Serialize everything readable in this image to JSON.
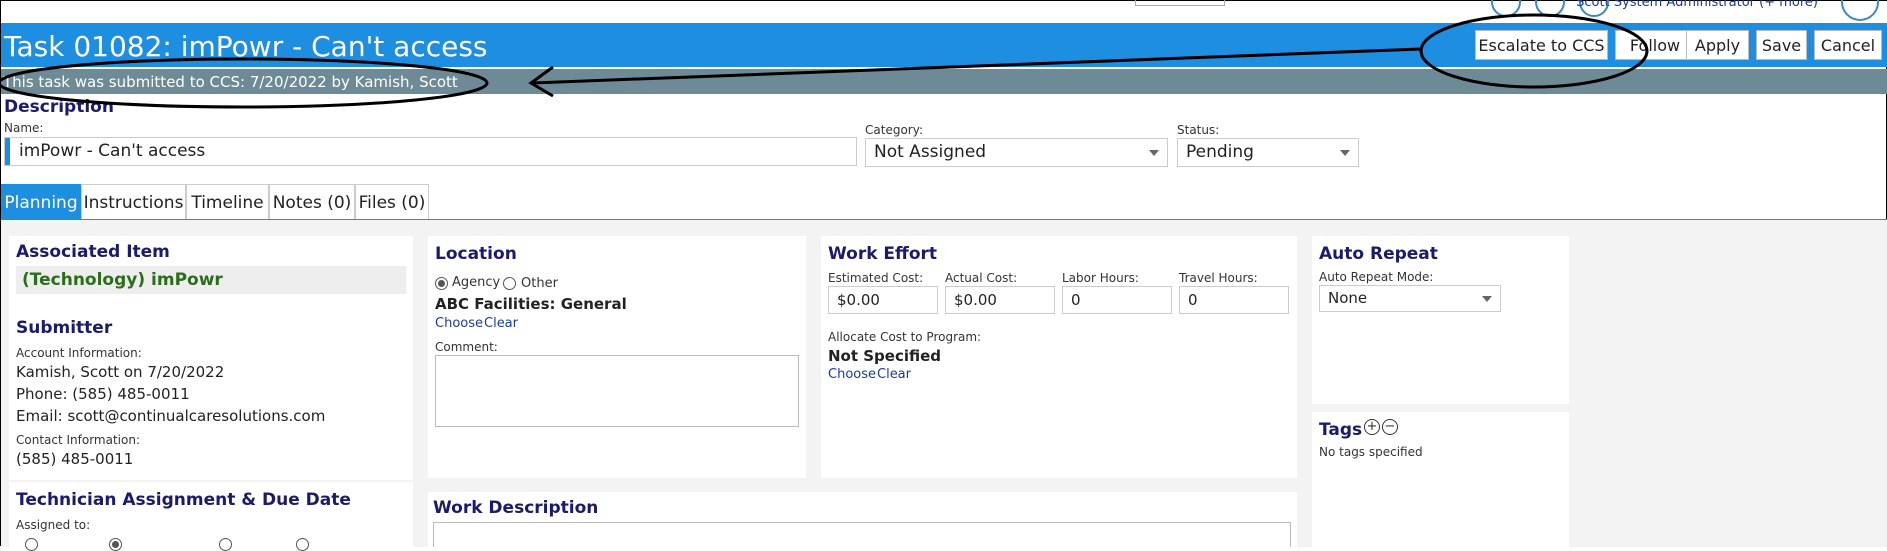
{
  "header": {
    "title": "Task 01082: imPowr - Can't access",
    "user_text": "Scott System Administrator (+ more)",
    "escalate_label": "Escalate to CCS",
    "follow_label": "Follow",
    "apply_label": "Apply",
    "save_label": "Save",
    "cancel_label": "Cancel"
  },
  "notice": "This task was submitted to CCS: 7/20/2022 by Kamish, Scott",
  "description": {
    "heading": "Description",
    "name_label": "Name:",
    "name_value": "imPowr - Can't access",
    "category_label": "Category:",
    "category_value": "Not Assigned",
    "status_label": "Status:",
    "status_value": "Pending"
  },
  "tabs": [
    {
      "label": "Planning"
    },
    {
      "label": "Instructions"
    },
    {
      "label": "Timeline"
    },
    {
      "label": "Notes (0)"
    },
    {
      "label": "Files (0)"
    }
  ],
  "associated": {
    "heading": "Associated Item",
    "value": "(Technology) imPowr"
  },
  "submitter": {
    "heading": "Submitter",
    "account_label": "Account Information:",
    "account_line": "Kamish, Scott on 7/20/2022",
    "phone_line": "Phone: (585) 485-0011",
    "email_line": "Email: scott@continualcaresolutions.com",
    "contact_label": "Contact Information:",
    "contact_line": "(585) 485-0011"
  },
  "technician": {
    "heading": "Technician Assignment & Due Date",
    "assigned_label": "Assigned to:"
  },
  "location": {
    "heading": "Location",
    "opt_agency": "Agency",
    "opt_other": "Other",
    "value": "ABC Facilities: General",
    "choose": "Choose",
    "clear": "Clear",
    "comment_label": "Comment:"
  },
  "work_effort": {
    "heading": "Work Effort",
    "est_label": "Estimated Cost:",
    "est_value": "$0.00",
    "act_label": "Actual Cost:",
    "act_value": "$0.00",
    "labor_label": "Labor Hours:",
    "labor_value": "0",
    "travel_label": "Travel Hours:",
    "travel_value": "0",
    "allocate_label": "Allocate Cost to Program:",
    "allocate_value": "Not Specified",
    "choose": "Choose",
    "clear": "Clear"
  },
  "work_description": {
    "heading": "Work Description"
  },
  "auto_repeat": {
    "heading": "Auto Repeat",
    "mode_label": "Auto Repeat Mode:",
    "mode_value": "None"
  },
  "tags": {
    "heading": "Tags",
    "add_symbol": "+",
    "remove_symbol": "−",
    "empty_text": "No tags specified"
  },
  "colors": {
    "accent": "#1d8ee0",
    "subbar": "#6f8a97",
    "heading": "#1a1a6e",
    "associated": "#2a6e1a"
  }
}
